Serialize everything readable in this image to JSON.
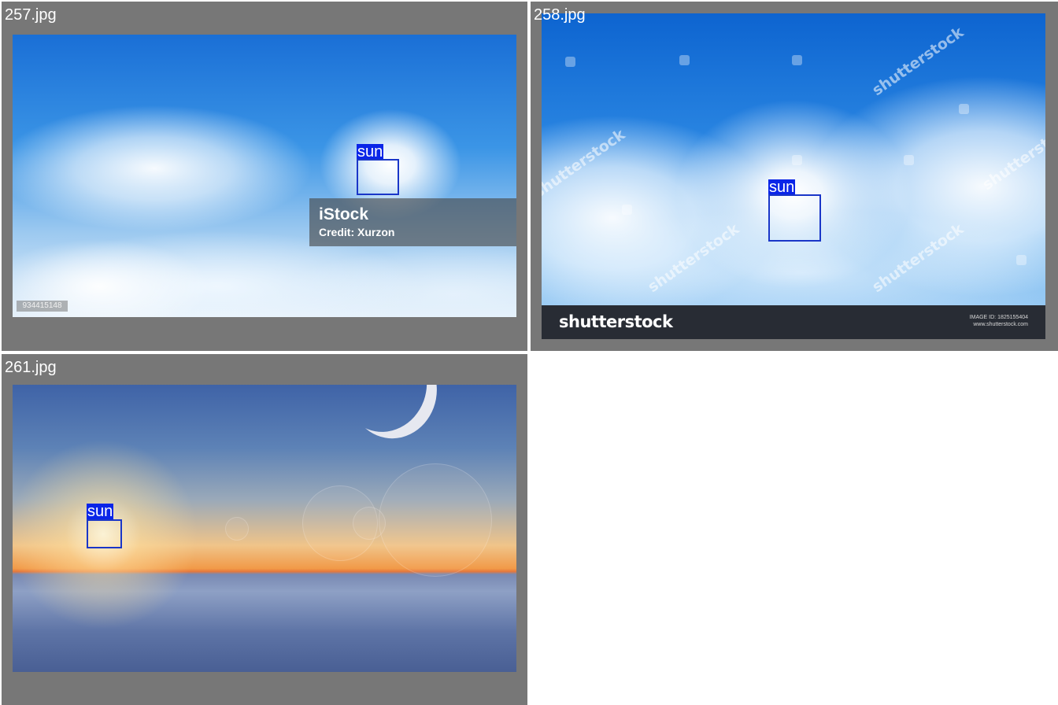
{
  "tiles": [
    {
      "filename": "257.jpg",
      "detections": [
        {
          "label": "sun"
        }
      ],
      "watermark": {
        "brand": "iStock",
        "credit": "Credit: Xurzon",
        "stock_id": "934415148"
      }
    },
    {
      "filename": "258.jpg",
      "detections": [
        {
          "label": "sun"
        }
      ],
      "watermark": {
        "text": "shutterstock",
        "footer_logo": "shutterstock",
        "image_id": "IMAGE ID: 1825155404",
        "site": "www.shutterstock.com"
      }
    },
    {
      "filename": "261.jpg",
      "detections": [
        {
          "label": "sun"
        }
      ]
    }
  ],
  "colors": {
    "tile_background": "#777777",
    "label_background": "#0a25e8",
    "box_border": "#1a36c8",
    "page_background": "#ffffff"
  }
}
